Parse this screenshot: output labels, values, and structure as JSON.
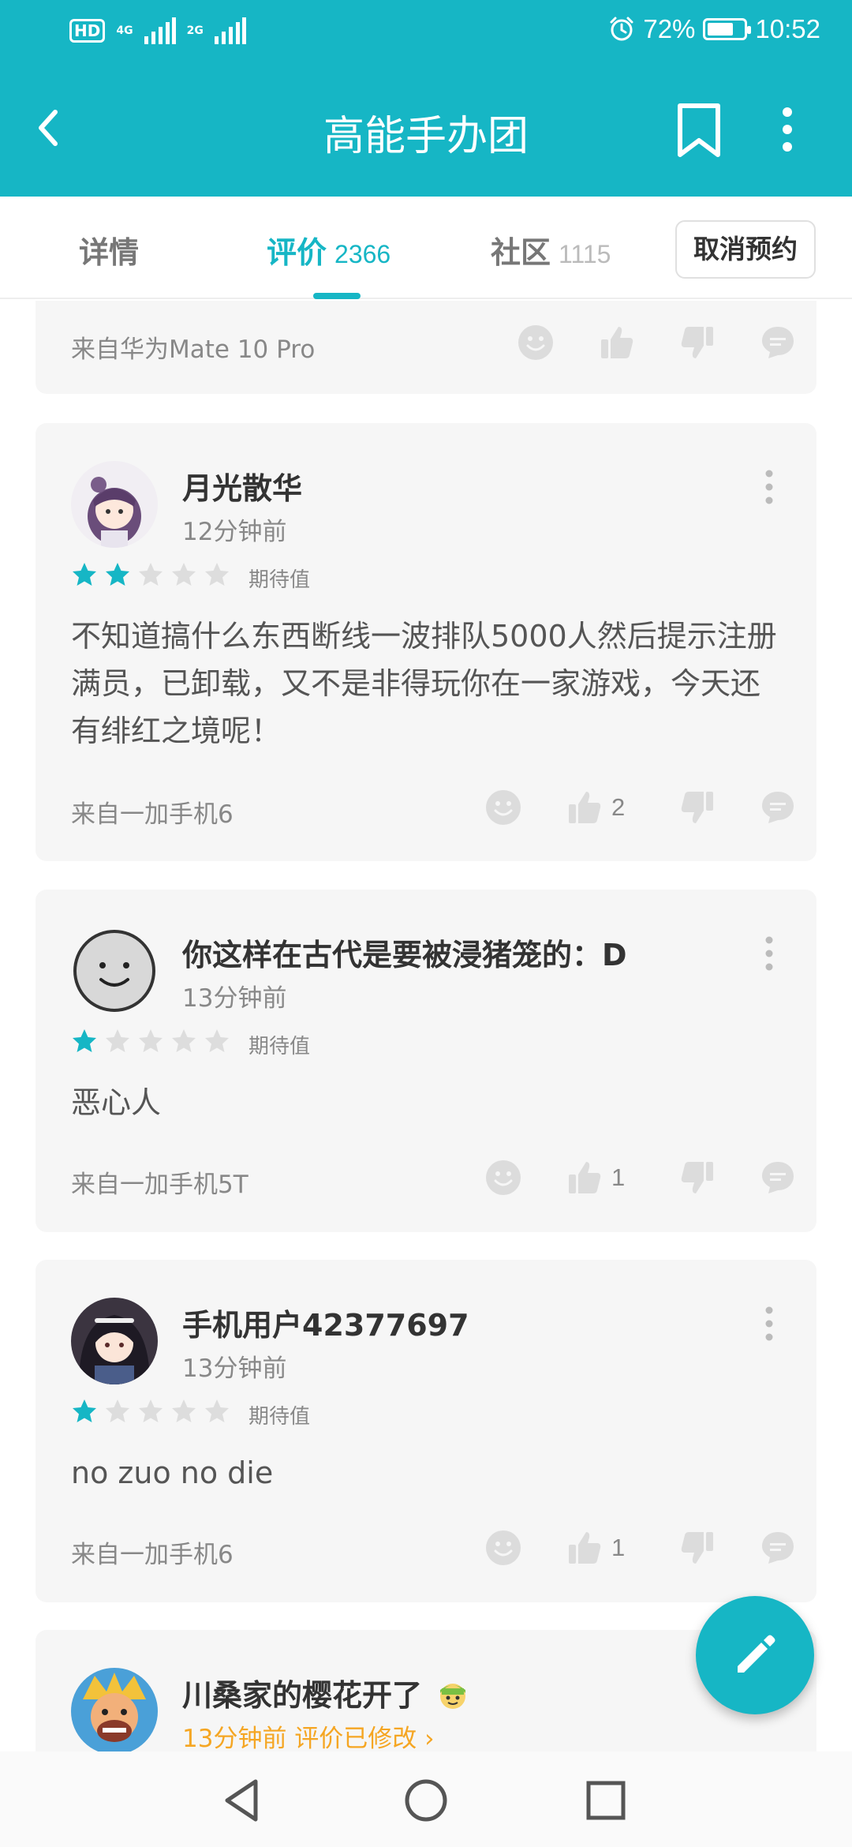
{
  "status_bar": {
    "hd": "HD",
    "sig1": "4G",
    "sig2": "2G",
    "battery_pct": "72%",
    "battery_level": 0.72,
    "time": "10:52"
  },
  "header": {
    "title": "高能手办团",
    "icons": [
      "back-arrow-icon",
      "bookmark-icon",
      "more-vertical-icon"
    ]
  },
  "tabs": [
    {
      "label": "详情",
      "count": ""
    },
    {
      "label": "评价",
      "count": "2366",
      "active": true
    },
    {
      "label": "社区",
      "count": "1115"
    }
  ],
  "cancel_button": "取消预约",
  "colors": {
    "accent": "#16b6c5",
    "star_on": "#16b6c5",
    "star_off": "#dddddd",
    "edited": "#f5a623"
  },
  "reviews": [
    {
      "device": "来自华为Mate 10 Pro",
      "likes": ""
    },
    {
      "name": "月光散华",
      "time": "12分钟前",
      "rating": 2,
      "rating_label": "期待值",
      "text": "不知道搞什么东西断线一波排队5000人然后提示注册满员，已卸载，又不是非得玩你在一家游戏，今天还有绯红之境呢！",
      "device": "来自一加手机6",
      "likes": "2"
    },
    {
      "name": "你这样在古代是要被浸猪笼的：D",
      "time": "13分钟前",
      "rating": 1,
      "rating_label": "期待值",
      "text": "恶心人",
      "device": "来自一加手机5T",
      "likes": "1"
    },
    {
      "name": "手机用户42377697",
      "time": "13分钟前",
      "rating": 1,
      "rating_label": "期待值",
      "text": "no zuo no die",
      "device": "来自一加手机6",
      "likes": "1"
    },
    {
      "name": "川桑家的樱花开了",
      "time": "13分钟前 评价已修改 ›"
    }
  ],
  "navbar": {
    "icons": [
      "back-triangle-icon",
      "home-circle-icon",
      "recents-square-icon"
    ]
  },
  "fab": {
    "icon": "edit-pencil-icon"
  }
}
